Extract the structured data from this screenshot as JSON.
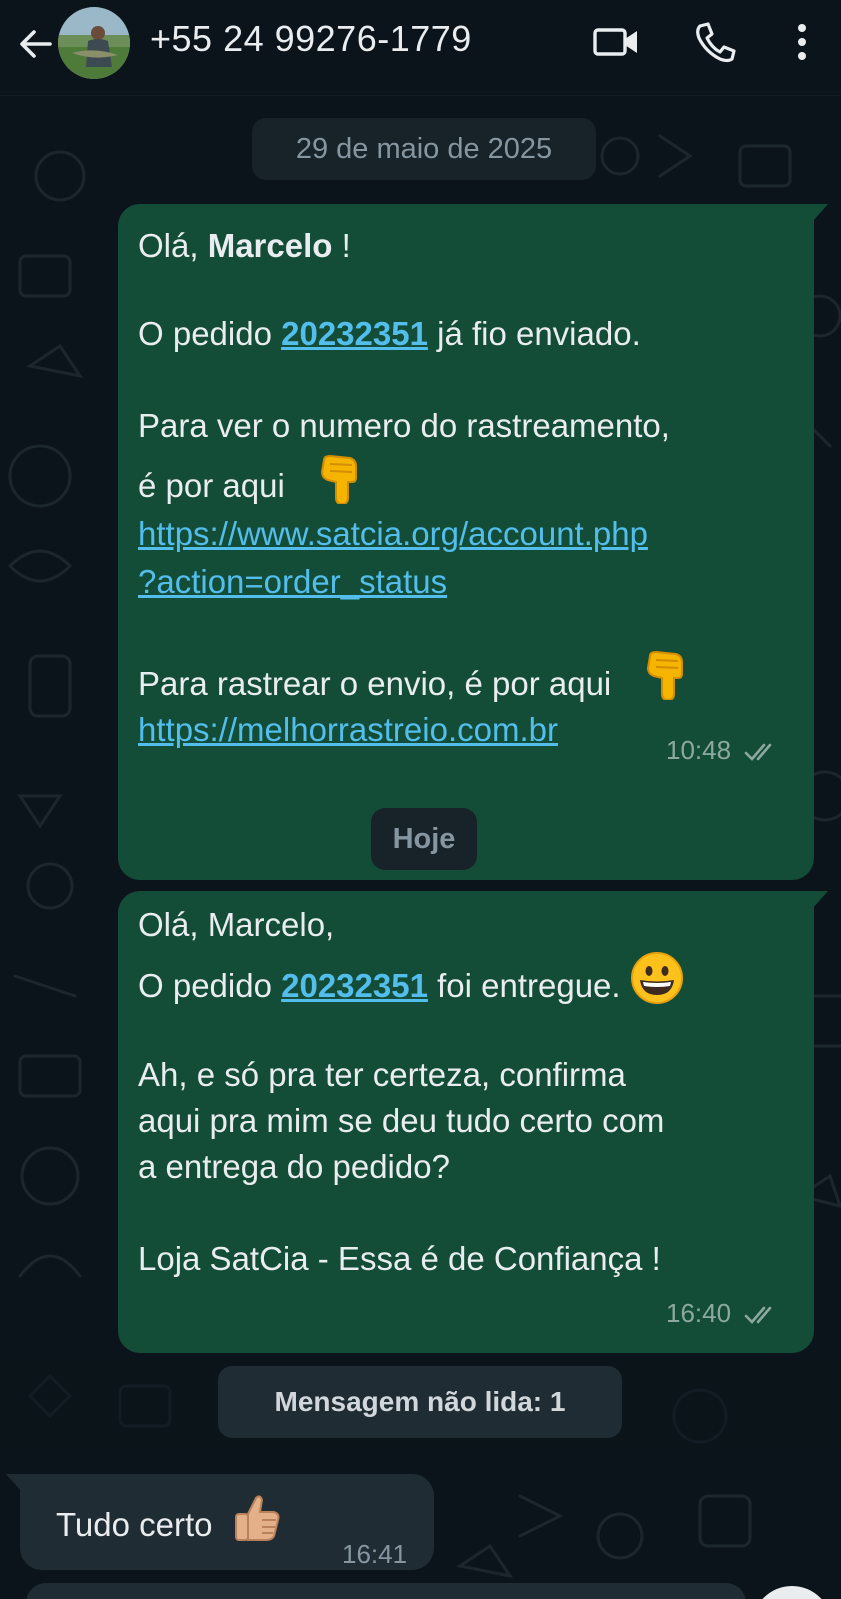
{
  "header": {
    "contact_name": "+55 24 99276-1779",
    "icons": [
      "arrow-back-icon",
      "avatar",
      "video-call-icon",
      "phone-icon",
      "more-vert-icon"
    ]
  },
  "chat": {
    "date_separator": "29 de maio de 2025",
    "today_separator": "Hoje",
    "unread_banner": "Mensagem não lida: 1",
    "message1": {
      "greeting_prefix": "Olá, ",
      "greeting_name": "Marcelo",
      "greeting_suffix": " !",
      "order_prefix": "O pedido ",
      "order_number": "20232351",
      "order_suffix": " já fio enviado.",
      "track_line1": "Para ver o numero do rastreamento,",
      "track_line2": "é por aqui",
      "url1_line1": "https://www.satcia.org/account.php",
      "url1_line2": "?action=order_status",
      "ship_line": "Para rastrear o envio, é por aqui",
      "url2": "https://melhorrastreio.com.br",
      "time": "10:48"
    },
    "message2": {
      "line1": "Olá, Marcelo,",
      "order_prefix": "O pedido ",
      "order_number": "20232351",
      "order_suffix": " foi entregue.",
      "line3": "Ah, e só pra ter certeza, confirma",
      "line4": "aqui pra mim se deu tudo certo com",
      "line5": "a entrega do pedido?",
      "signature": "Loja SatCia - Essa é de Confiança !",
      "time": "16:40"
    },
    "message3": {
      "text": "Tudo certo",
      "time": "16:41"
    }
  },
  "colors": {
    "background": "#0b141a",
    "outgoing_bubble": "#144d37",
    "incoming_bubble": "#202c33",
    "link": "#53bdeb",
    "text": "#e9edef",
    "meta": "#8696a0"
  }
}
